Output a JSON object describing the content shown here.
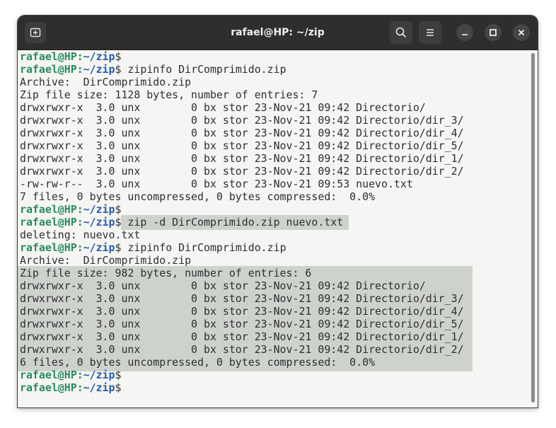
{
  "window": {
    "title": "rafael@HP: ~/zip"
  },
  "titlebar": {
    "icons": [
      "new-tab-icon",
      "search-icon",
      "hamburger-menu-icon",
      "minimize-icon",
      "maximize-icon",
      "close-icon"
    ]
  },
  "colors": {
    "titlebar_bg": "#2e2e2e",
    "terminal_bg": "#f5f5f3",
    "prompt_user": "#2a8a5e",
    "prompt_path": "#2a5aa8",
    "highlight": "#cdd3cc"
  },
  "terminal": {
    "prompt_user": "rafael@HP",
    "prompt_sep": ":",
    "prompt_path": "~/zip",
    "prompt_dollar": "$",
    "lines": [
      {
        "cmd": ""
      },
      {
        "cmd": " zipinfo DirComprimido.zip"
      },
      {
        "text": "Archive:  DirComprimido.zip"
      },
      {
        "text": "Zip file size: 1128 bytes, number of entries: 7"
      },
      {
        "text": "drwxrwxr-x  3.0 unx        0 bx stor 23-Nov-21 09:42 Directorio/"
      },
      {
        "text": "drwxrwxr-x  3.0 unx        0 bx stor 23-Nov-21 09:42 Directorio/dir_3/"
      },
      {
        "text": "drwxrwxr-x  3.0 unx        0 bx stor 23-Nov-21 09:42 Directorio/dir_4/"
      },
      {
        "text": "drwxrwxr-x  3.0 unx        0 bx stor 23-Nov-21 09:42 Directorio/dir_5/"
      },
      {
        "text": "drwxrwxr-x  3.0 unx        0 bx stor 23-Nov-21 09:42 Directorio/dir_1/"
      },
      {
        "text": "drwxrwxr-x  3.0 unx        0 bx stor 23-Nov-21 09:42 Directorio/dir_2/"
      },
      {
        "text": "-rw-rw-r--  3.0 unx        0 bx stor 23-Nov-21 09:53 nuevo.txt"
      },
      {
        "text": "7 files, 0 bytes uncompressed, 0 bytes compressed:  0.0%"
      },
      {
        "cmd": ""
      },
      {
        "cmd": " zip -d DirComprimido.zip nuevo.txt"
      },
      {
        "text": "deleting: nuevo.txt"
      },
      {
        "cmd": " zipinfo DirComprimido.zip"
      },
      {
        "text": "Archive:  DirComprimido.zip"
      },
      {
        "text": "Zip file size: 982 bytes, number of entries: 6"
      },
      {
        "text": "drwxrwxr-x  3.0 unx        0 bx stor 23-Nov-21 09:42 Directorio/"
      },
      {
        "text": "drwxrwxr-x  3.0 unx        0 bx stor 23-Nov-21 09:42 Directorio/dir_3/"
      },
      {
        "text": "drwxrwxr-x  3.0 unx        0 bx stor 23-Nov-21 09:42 Directorio/dir_4/"
      },
      {
        "text": "drwxrwxr-x  3.0 unx        0 bx stor 23-Nov-21 09:42 Directorio/dir_5/"
      },
      {
        "text": "drwxrwxr-x  3.0 unx        0 bx stor 23-Nov-21 09:42 Directorio/dir_1/"
      },
      {
        "text": "drwxrwxr-x  3.0 unx        0 bx stor 23-Nov-21 09:42 Directorio/dir_2/"
      },
      {
        "text": "6 files, 0 bytes uncompressed, 0 bytes compressed:  0.0%"
      },
      {
        "cmd": ""
      },
      {
        "cmd": ""
      }
    ]
  }
}
